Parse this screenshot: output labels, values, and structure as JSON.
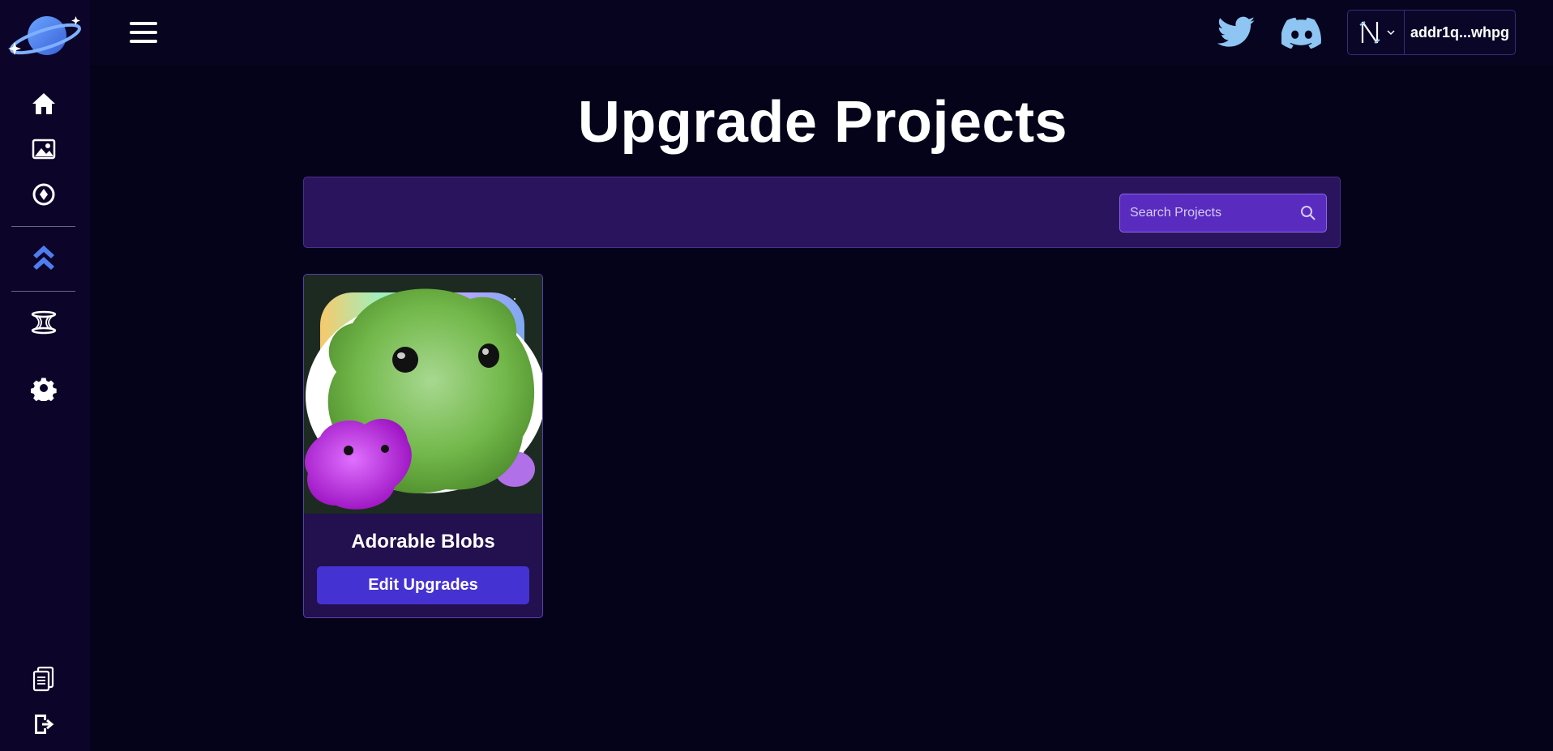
{
  "sidebar": {
    "logo": "planet-logo",
    "items": [
      {
        "icon": "home-icon"
      },
      {
        "icon": "image-icon"
      },
      {
        "icon": "compass-icon"
      },
      {
        "icon": "upgrade-chevrons-icon",
        "active": true
      },
      {
        "icon": "hourglass-spool-icon"
      },
      {
        "icon": "gear-icon"
      }
    ],
    "bottom_items": [
      {
        "icon": "documents-icon"
      },
      {
        "icon": "logout-icon"
      }
    ]
  },
  "topbar": {
    "menu_icon": "hamburger-icon",
    "social": [
      {
        "icon": "twitter-icon"
      },
      {
        "icon": "discord-icon"
      }
    ],
    "wallet": {
      "address": "addr1q...whpg",
      "wallet_icon": "nami-wallet-icon"
    }
  },
  "main": {
    "title": "Upgrade Projects",
    "search": {
      "placeholder": "Search Projects",
      "value": ""
    },
    "projects": [
      {
        "name": "Adorable Blobs",
        "button_label": "Edit Upgrades"
      }
    ]
  },
  "colors": {
    "background": "#05031a",
    "sidebar": "#0c0529",
    "panel": "#2b145e",
    "search": "#5a2bbf",
    "button": "#4532d2",
    "accent_icon": "#4f7df0",
    "social_icon": "#8ec5f2"
  }
}
